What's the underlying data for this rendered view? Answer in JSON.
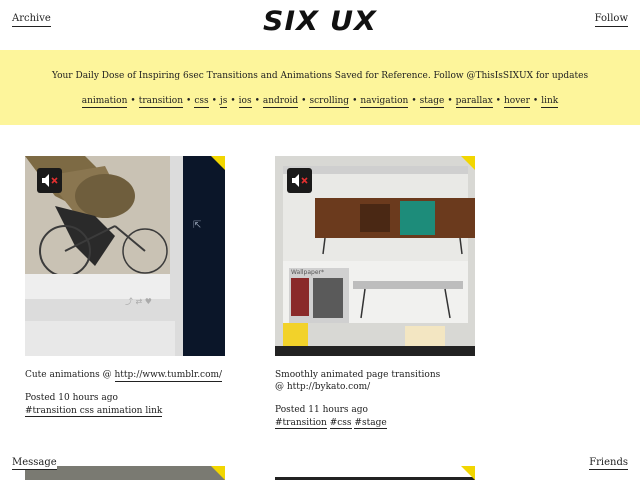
{
  "header": {
    "archive": "Archive",
    "logo": "SIX UX",
    "follow": "Follow"
  },
  "banner": {
    "tagline": "Your Daily Dose of Inspiring 6sec Transitions and Animations Saved for Reference. Follow @ThisIsSIXUX for updates",
    "tags": [
      "animation",
      "transition",
      "css",
      "js",
      "ios",
      "android",
      "scrolling",
      "navigation",
      "stage",
      "parallax",
      "hover",
      "link"
    ]
  },
  "posts": [
    {
      "caption": "Cute animations @",
      "link": "http://www.tumblr.com/",
      "posted": "Posted 10 hours ago",
      "tags": "#transition css animation link",
      "icon": "mute-icon"
    },
    {
      "caption": "Smoothly animated page transitions",
      "caption2": "@ http://bykato.com/",
      "posted": "Posted 11 hours ago",
      "tags": [
        "#transition",
        "#css",
        "#stage"
      ],
      "icon": "mute-icon"
    }
  ],
  "footer": {
    "message": "Message",
    "friends": "Friends"
  },
  "colors": {
    "banner": "#fdf59b",
    "corner": "#f2d600"
  }
}
